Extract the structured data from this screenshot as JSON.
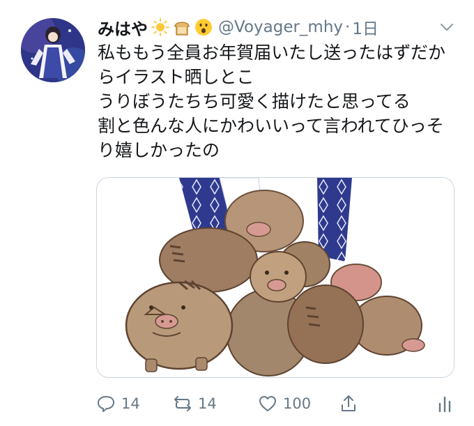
{
  "tweet": {
    "display_name": "みはや",
    "emojis": [
      "sun-icon",
      "bread-icon",
      "surprised-face-icon"
    ],
    "handle": "@Voyager_mhy",
    "separator": "·",
    "time": "1日",
    "lines": [
      "私ももう全員お年賀届いたし送ったはずだか",
      "らイラスト晒しとこ",
      "うりぼうたちち可愛く描けたと思ってる",
      "割と色んな人にかわいいって言われてひっそ",
      "り嬉しかったの"
    ]
  },
  "actions": {
    "replies": "14",
    "retweets": "14",
    "likes": "100"
  },
  "colors": {
    "text": "#14171a",
    "muted": "#657786",
    "border": "#ccd6dd",
    "boar_brown": "#a88866",
    "boar_pink": "#d4948c",
    "kimono_blue": "#2f3a8f"
  }
}
